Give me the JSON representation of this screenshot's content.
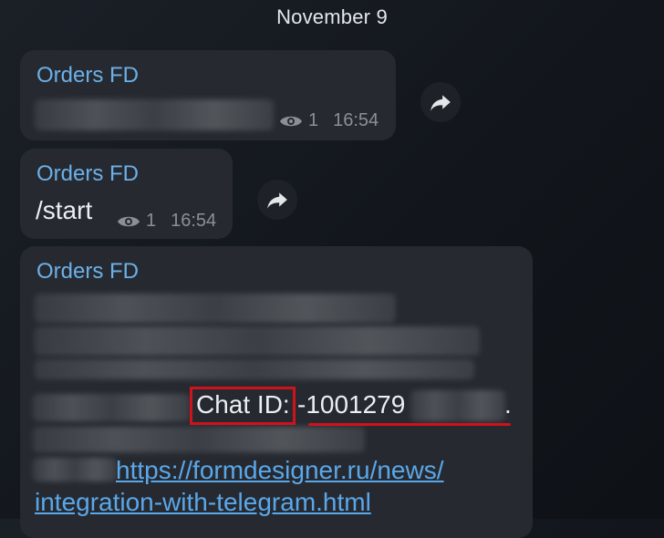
{
  "date_header": "November 9",
  "messages": [
    {
      "sender": "Orders FD",
      "text": "",
      "views": "1",
      "time": "16:54"
    },
    {
      "sender": "Orders FD",
      "text": "/start",
      "views": "1",
      "time": "16:54"
    },
    {
      "sender": "Orders FD",
      "chat_id_label": "Chat ID:",
      "chat_id_value": "-1001279",
      "chat_id_suffix": ".",
      "link_line1": "https://formdesigner.ru/news/",
      "link_line2": "integration-with-telegram.html"
    }
  ],
  "icons": {
    "views": "eye-icon",
    "forward": "share-arrow-icon"
  },
  "colors": {
    "sender": "#6cb0e8",
    "link": "#5aa7ea",
    "highlight": "#d0121b"
  }
}
